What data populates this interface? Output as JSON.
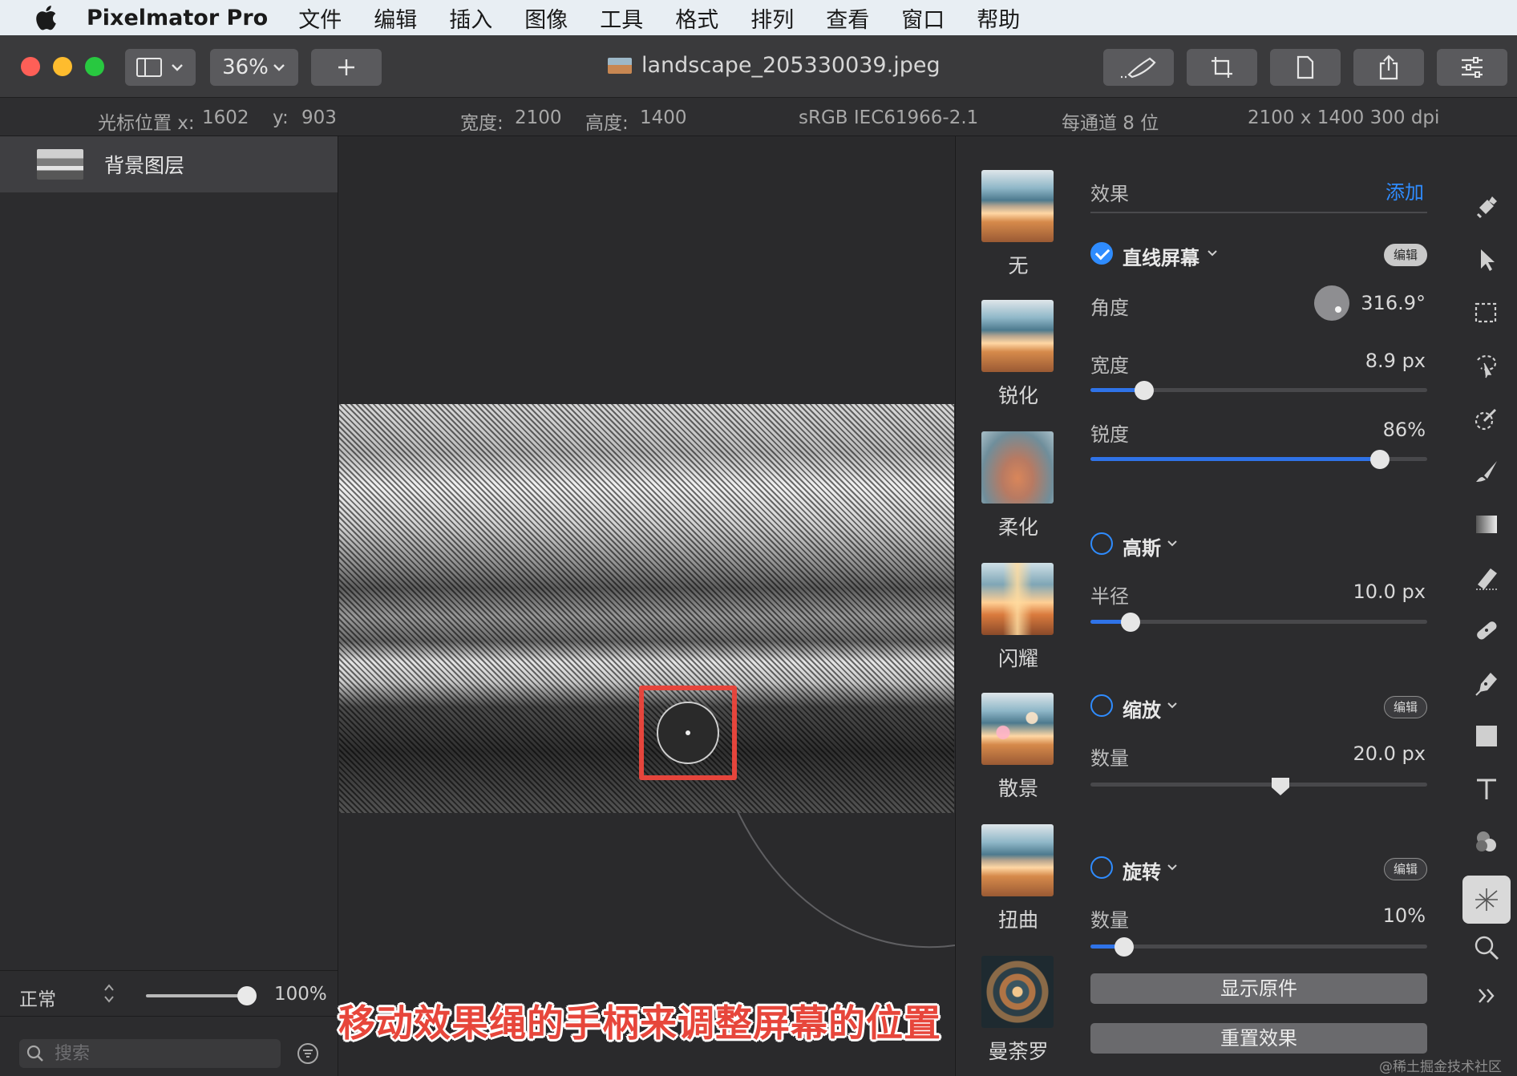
{
  "menubar": {
    "app_name": "Pixelmator Pro",
    "items": [
      "文件",
      "编辑",
      "插入",
      "图像",
      "工具",
      "格式",
      "排列",
      "查看",
      "窗口",
      "帮助"
    ]
  },
  "toolbar": {
    "zoom": "36%",
    "document_title": "landscape_205330039.jpeg"
  },
  "infobar": {
    "cursor_label": "光标位置 x:",
    "cursor_x": "1602",
    "cursor_y_label": "y:",
    "cursor_y": "903",
    "width_label": "宽度:",
    "width": "2100",
    "height_label": "高度:",
    "height": "1400",
    "color_profile": "sRGB IEC61966-2.1",
    "bit_depth": "每通道 8 位",
    "dimensions_dpi": "2100 x 1400 300 dpi"
  },
  "layers": {
    "items": [
      {
        "name": "背景图层"
      }
    ],
    "blend_mode": "正常",
    "opacity": "100%",
    "opacity_fraction": 1.0,
    "search_placeholder": "搜索"
  },
  "presets": [
    {
      "label": "无"
    },
    {
      "label": "锐化"
    },
    {
      "label": "柔化"
    },
    {
      "label": "闪耀"
    },
    {
      "label": "散景"
    },
    {
      "label": "扭曲"
    },
    {
      "label": "曼荼罗"
    }
  ],
  "effects": {
    "title": "效果",
    "add_label": "添加",
    "edit_label": "编辑",
    "line_screen": {
      "name": "直线屏幕",
      "enabled": true,
      "angle_label": "角度",
      "angle_value": "316.9°",
      "width_label": "宽度",
      "width_value": "8.9 px",
      "width_fraction": 0.16,
      "sharpness_label": "锐度",
      "sharpness_value": "86%",
      "sharpness_fraction": 0.86
    },
    "gaussian": {
      "name": "高斯",
      "enabled": false,
      "radius_label": "半径",
      "radius_value": "10.0 px",
      "radius_fraction": 0.12
    },
    "zoom": {
      "name": "缩放",
      "enabled": false,
      "amount_label": "数量",
      "amount_value": "20.0 px",
      "amount_fraction": 0.6
    },
    "spin": {
      "name": "旋转",
      "enabled": false,
      "amount_label": "数量",
      "amount_value": "10%",
      "amount_fraction": 0.1
    },
    "show_original": "显示原件",
    "reset_effects": "重置效果"
  },
  "annotation": {
    "caption": "移动效果绳的手柄来调整屏幕的位置"
  },
  "watermark": "@稀土掘金技术社区",
  "colors": {
    "accent": "#2f8cff",
    "annotation_red": "#e5453c"
  }
}
